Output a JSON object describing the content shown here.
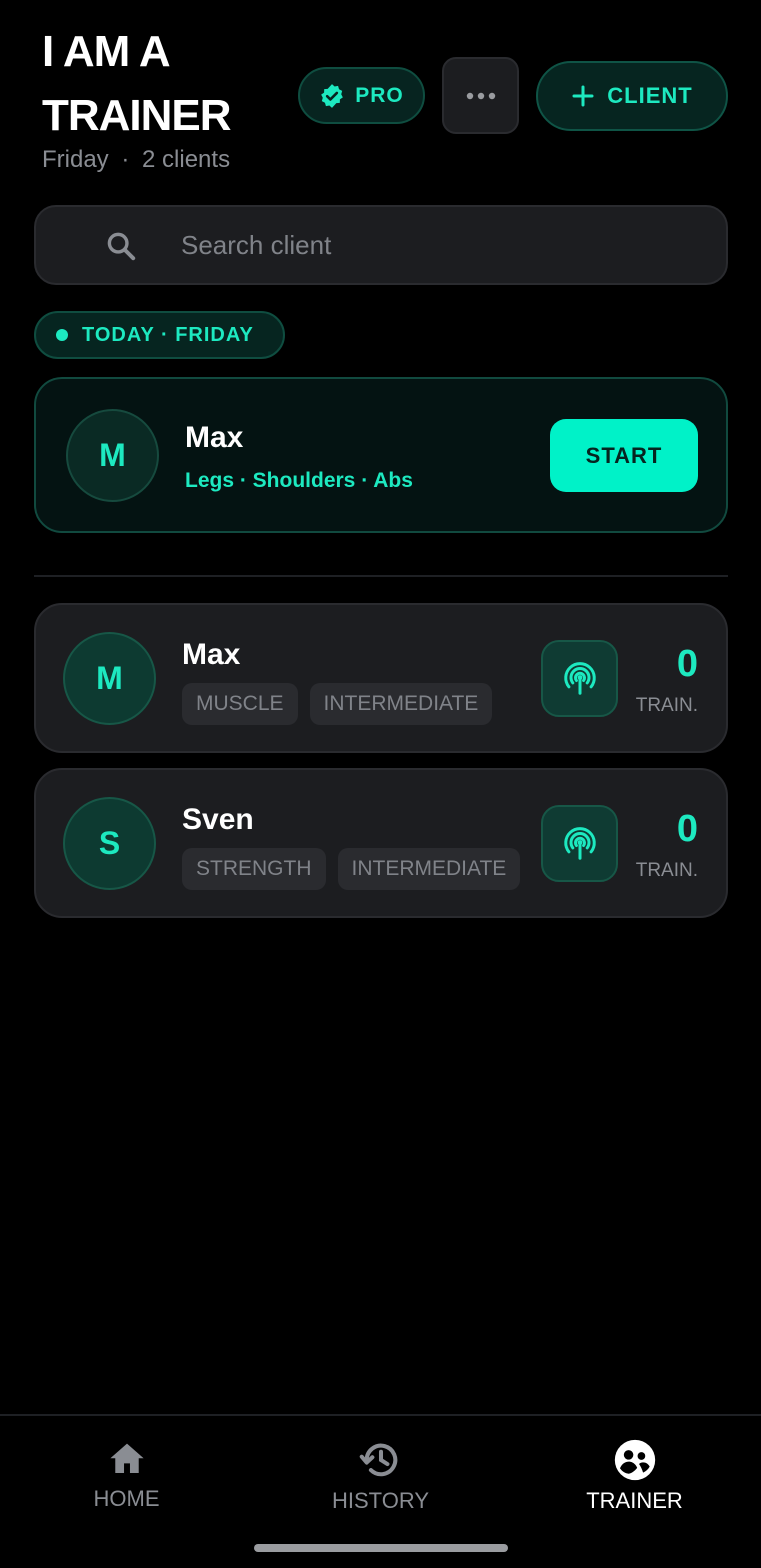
{
  "header": {
    "title_line1": "I AM A",
    "title_line2": "TRAINER",
    "day": "Friday",
    "client_count": "2 clients",
    "pro_label": "PRO",
    "more_icon": "more-horizontal-icon",
    "add_client_label": "CLIENT"
  },
  "search": {
    "placeholder": "Search client",
    "value": ""
  },
  "today": {
    "chip_label": "TODAY · FRIDAY",
    "client_initial": "M",
    "client_name": "Max",
    "muscles": "Legs · Shoulders · Abs",
    "start_label": "START"
  },
  "clients": [
    {
      "initial": "M",
      "name": "Max",
      "tags": [
        "MUSCLE",
        "INTERMEDIATE"
      ],
      "trainings_count": "0",
      "trainings_label": "TRAIN."
    },
    {
      "initial": "S",
      "name": "Sven",
      "tags": [
        "STRENGTH",
        "INTERMEDIATE"
      ],
      "trainings_count": "0",
      "trainings_label": "TRAIN."
    }
  ],
  "nav": {
    "items": [
      {
        "label": "HOME",
        "icon": "home-icon"
      },
      {
        "label": "HISTORY",
        "icon": "history-icon"
      },
      {
        "label": "TRAINER",
        "icon": "trainer-icon"
      }
    ],
    "active": "TRAINER"
  },
  "colors": {
    "accent": "#1de9c0",
    "start_button": "#00f2c8",
    "background": "#000000",
    "card": "#1c1d20"
  }
}
